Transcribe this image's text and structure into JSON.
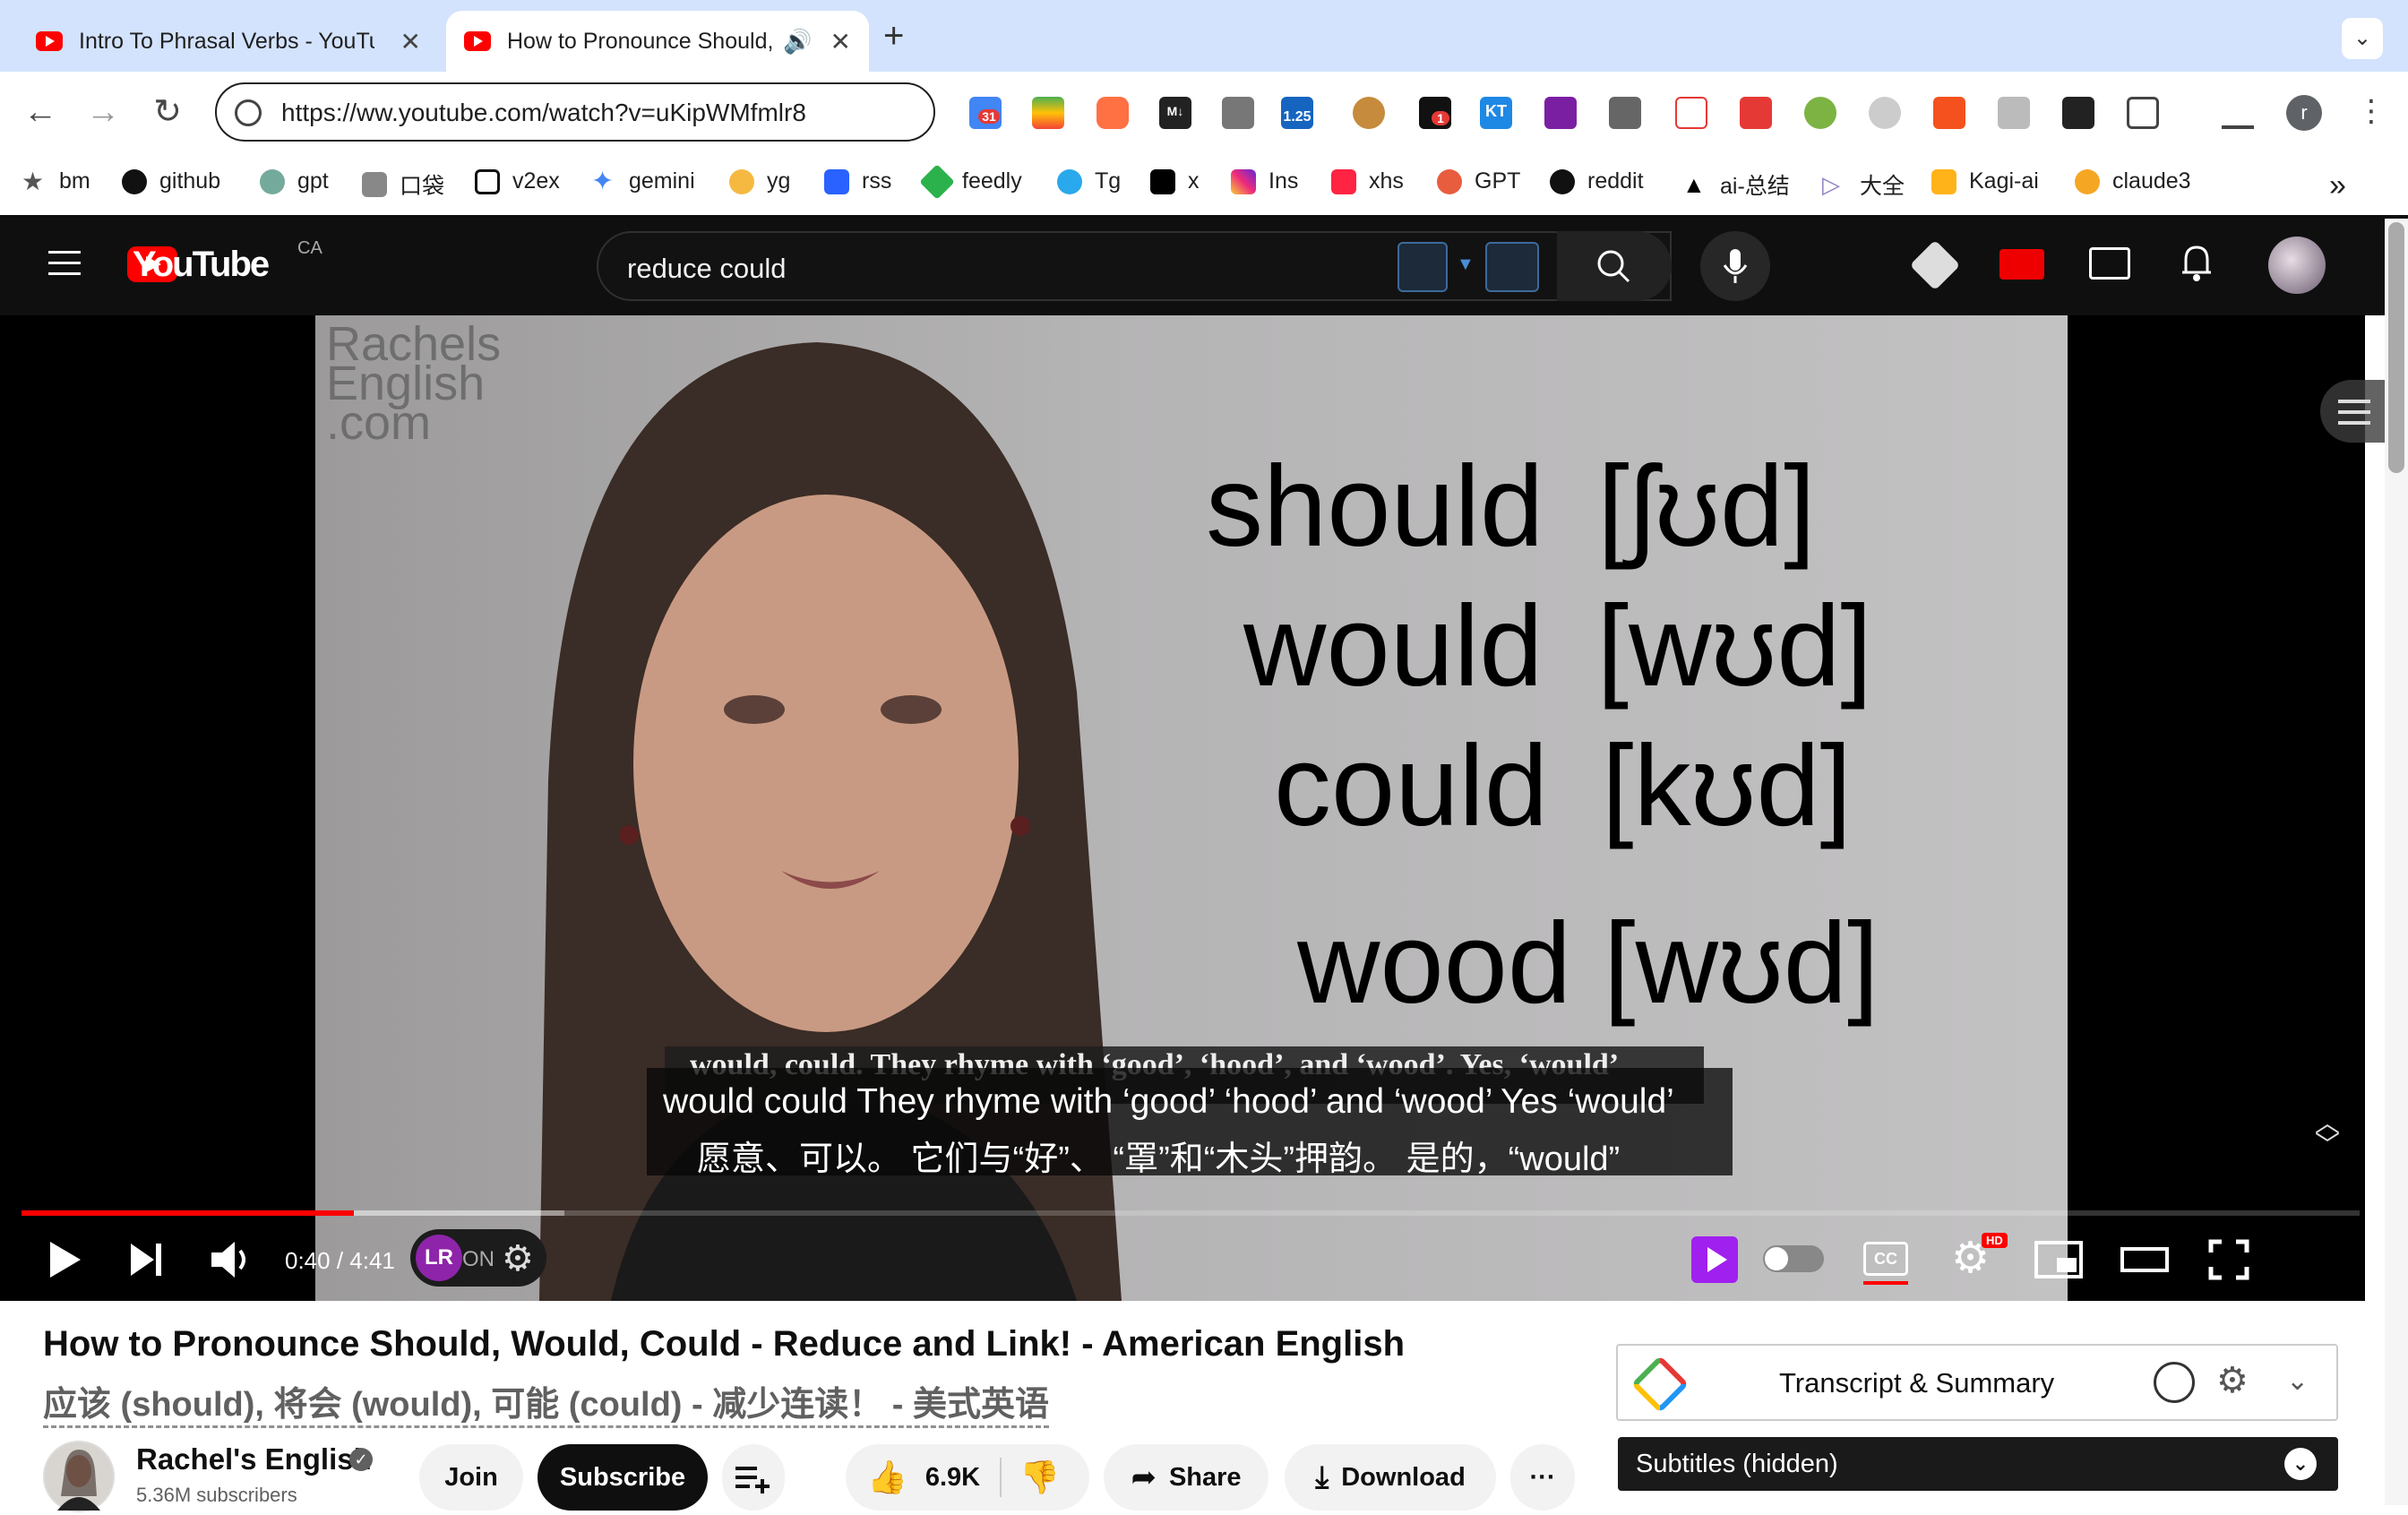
{
  "browser": {
    "tabs": [
      {
        "title": "Intro To Phrasal Verbs - YouTube",
        "active": false
      },
      {
        "title": "How to Pronounce Should, Would, Could",
        "active": true
      }
    ],
    "new_tab_label": "+",
    "url": "https://ww.youtube.com/watch?v=uKipWMfmlr8",
    "extension_badges": {
      "calendar": "31",
      "speed": "1.25",
      "notif": "1",
      "kt": "KT"
    },
    "profile_initial": "r",
    "bookmarks": [
      "bm",
      "github",
      "gpt",
      "口袋",
      "v2ex",
      "gemini",
      "yg",
      "rss",
      "feedly",
      "Tg",
      "x",
      "Ins",
      "xhs",
      "GPT",
      "reddit",
      "ai-总结",
      "大全",
      "Kagi-ai",
      "claude3"
    ],
    "bookmarks_overflow": "»"
  },
  "youtube": {
    "logo_text": "YouTube",
    "country": "CA",
    "search_value": "reduce could"
  },
  "video": {
    "brand_watermark": [
      "Rachels",
      "English",
      ".com"
    ],
    "words": [
      {
        "word": "should",
        "ipa": "[ʃʊd]"
      },
      {
        "word": "would",
        "ipa": "[wʊd]"
      },
      {
        "word": "could",
        "ipa": "[kʊd]"
      },
      {
        "word": "wood",
        "ipa": "[wʊd]"
      }
    ],
    "burned_caption": "would, could. They rhyme with ‘good’, ‘hood’, and ‘wood’. Yes, ‘would’",
    "subtitle_en": "would could They rhyme with ‘good’ ‘hood’ and ‘wood’ Yes ‘would’",
    "subtitle_cn": "愿意、可以。 它们与“好”、 “罩”和“木头”押韵。 是的，“would”",
    "time_current": "0:40",
    "time_total": "4:41",
    "time_display": "0:40 / 4:41",
    "progress_fraction": 0.142,
    "buffer_fraction": 0.232,
    "lr_badge": "LR",
    "lr_state": "ON",
    "hd_badge": "HD",
    "cc_label": "CC"
  },
  "meta": {
    "title": "How to Pronounce Should, Would, Could - Reduce and Link! - American English",
    "title_cn": "应该 (should), 将会 (would), 可能 (could) - 减少连读！ - 美式英语",
    "channel": "Rachel's English",
    "subscribers": "5.36M subscribers",
    "join": "Join",
    "subscribe": "Subscribe",
    "likes": "6.9K",
    "share": "Share",
    "download": "Download",
    "more": "···"
  },
  "sidepanel": {
    "transcript_label": "Transcript & Summary",
    "subtitles_label": "Subtitles (hidden)"
  },
  "colors": {
    "youtube_red": "#ff0000",
    "tabstrip": "#d3e3fd",
    "dark_bg": "#0f0f0f"
  }
}
